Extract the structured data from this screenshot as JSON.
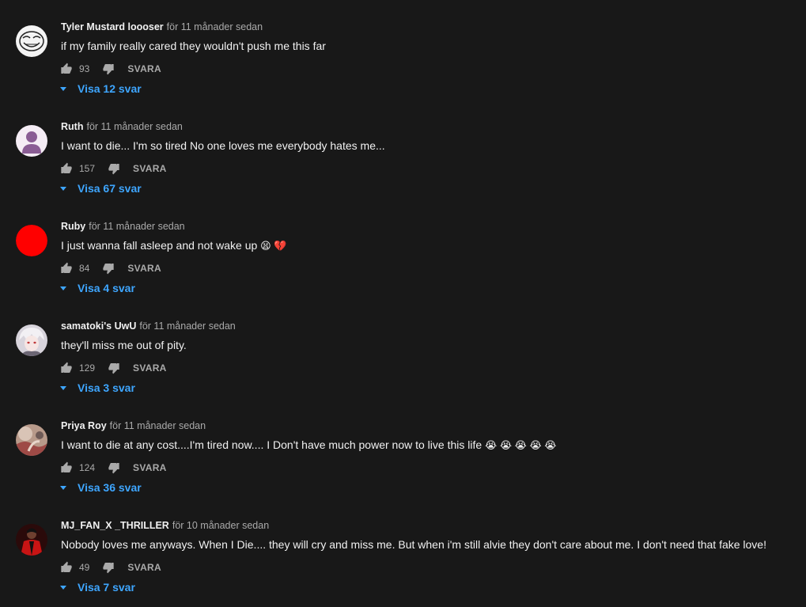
{
  "like_icon": "thumb-up-icon",
  "dislike_icon": "thumb-down-icon",
  "accent_color": "#3ea6ff",
  "comments": [
    {
      "author": "Tyler Mustard loooser",
      "time": "för 11 månader sedan",
      "text": "if my family really cared they wouldn't push me this far",
      "emoji": "",
      "likes": "93",
      "reply_label": "SVARA",
      "replies_label": "Visa 12 svar",
      "avatar": "trollface-avatar"
    },
    {
      "author": "Ruth",
      "time": "för 11 månader sedan",
      "text": "I want to die...  I'm so tired No one loves me everybody hates me...",
      "emoji": "",
      "likes": "157",
      "reply_label": "SVARA",
      "replies_label": "Visa 67 svar",
      "avatar": "default-person-avatar"
    },
    {
      "author": "Ruby",
      "time": "för 11 månader sedan",
      "text": "I just wanna fall asleep and not wake up",
      "emoji": "😫 💔",
      "likes": "84",
      "reply_label": "SVARA",
      "replies_label": "Visa 4 svar",
      "avatar": "red-circle-avatar"
    },
    {
      "author": "samatoki's UwU",
      "time": "för 11 månader sedan",
      "text": "they'll miss me out of pity.",
      "emoji": "",
      "likes": "129",
      "reply_label": "SVARA",
      "replies_label": "Visa 3 svar",
      "avatar": "anime-avatar"
    },
    {
      "author": "Priya Roy",
      "time": "för 11 månader sedan",
      "text": "I want to die at any cost....I'm tired now.... I Don't have much power now to live this life",
      "emoji": "😭 😭 😭 😭 😭",
      "likes": "124",
      "reply_label": "SVARA",
      "replies_label": "Visa 36 svar",
      "avatar": "photo-avatar"
    },
    {
      "author": "MJ_FAN_X _THRILLER",
      "time": "för 10 månader sedan",
      "text": "Nobody loves me anyways. When I Die.... they will cry and miss me. But when i'm still alvie they don't care about me. I don't need that fake love!",
      "emoji": "",
      "likes": "49",
      "reply_label": "SVARA",
      "replies_label": "Visa 7 svar",
      "avatar": "thriller-avatar"
    }
  ]
}
